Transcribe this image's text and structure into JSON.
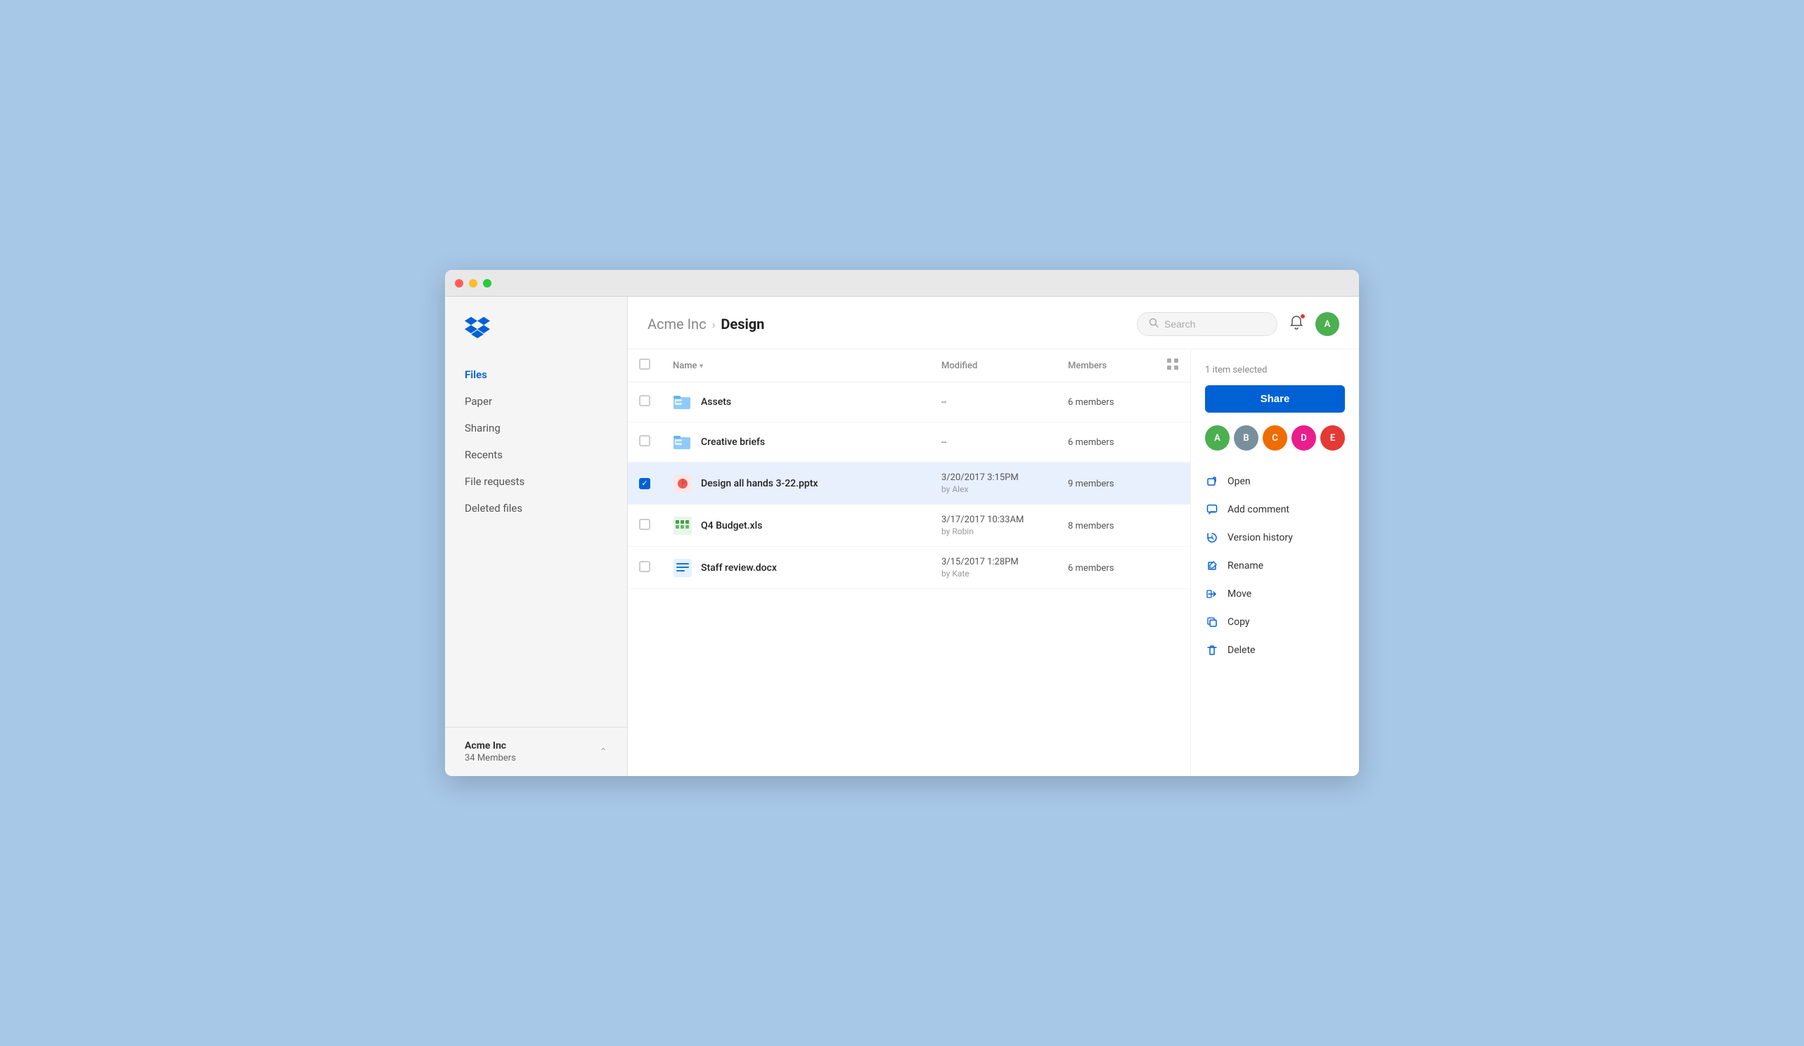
{
  "window": {
    "traffic_lights": [
      "red",
      "yellow",
      "green"
    ]
  },
  "sidebar": {
    "logo_alt": "Dropbox logo",
    "nav_items": [
      {
        "label": "Files",
        "active": true,
        "id": "files"
      },
      {
        "label": "Paper",
        "active": false,
        "id": "paper"
      },
      {
        "label": "Sharing",
        "active": false,
        "id": "sharing"
      },
      {
        "label": "Recents",
        "active": false,
        "id": "recents"
      },
      {
        "label": "File requests",
        "active": false,
        "id": "file-requests"
      },
      {
        "label": "Deleted files",
        "active": false,
        "id": "deleted-files"
      }
    ],
    "workspace": {
      "name": "Acme Inc",
      "members_label": "34 Members"
    }
  },
  "header": {
    "breadcrumb_parent": "Acme Inc",
    "breadcrumb_sep": "›",
    "breadcrumb_current": "Design",
    "search_placeholder": "Search"
  },
  "file_table": {
    "columns": {
      "name": "Name",
      "modified": "Modified",
      "members": "Members"
    },
    "files": [
      {
        "id": "assets",
        "name": "Assets",
        "type": "folder",
        "icon": "folder-group",
        "modified": "--",
        "modified_by": "",
        "members": "6 members",
        "selected": false
      },
      {
        "id": "creative-briefs",
        "name": "Creative briefs",
        "type": "folder",
        "icon": "folder-group",
        "modified": "--",
        "modified_by": "",
        "members": "6 members",
        "selected": false
      },
      {
        "id": "design-all-hands",
        "name": "Design all hands 3-22.pptx",
        "type": "pptx",
        "icon": "pptx",
        "modified": "3/20/2017 3:15PM",
        "modified_by": "by Alex",
        "members": "9 members",
        "selected": true
      },
      {
        "id": "q4-budget",
        "name": "Q4 Budget.xls",
        "type": "xls",
        "icon": "xls",
        "modified": "3/17/2017 10:33AM",
        "modified_by": "by Robin",
        "members": "8 members",
        "selected": false
      },
      {
        "id": "staff-review",
        "name": "Staff review.docx",
        "type": "docx",
        "icon": "docx",
        "modified": "3/15/2017 1:28PM",
        "modified_by": "by Kate",
        "members": "6 members",
        "selected": false
      }
    ]
  },
  "right_panel": {
    "selected_label": "1 item selected",
    "share_button": "Share",
    "member_avatars": [
      {
        "color": "#4caf50",
        "initial": "A"
      },
      {
        "color": "#78909c",
        "initial": "B"
      },
      {
        "color": "#ef6c00",
        "initial": "C"
      },
      {
        "color": "#e91e8c",
        "initial": "D"
      },
      {
        "color": "#e53935",
        "initial": "E"
      }
    ],
    "actions": [
      {
        "label": "Open",
        "icon": "open-icon",
        "id": "open"
      },
      {
        "label": "Add comment",
        "icon": "comment-icon",
        "id": "comment"
      },
      {
        "label": "Version history",
        "icon": "history-icon",
        "id": "version-history"
      },
      {
        "label": "Rename",
        "icon": "rename-icon",
        "id": "rename"
      },
      {
        "label": "Move",
        "icon": "move-icon",
        "id": "move"
      },
      {
        "label": "Copy",
        "icon": "copy-icon",
        "id": "copy"
      },
      {
        "label": "Delete",
        "icon": "delete-icon",
        "id": "delete"
      }
    ]
  }
}
